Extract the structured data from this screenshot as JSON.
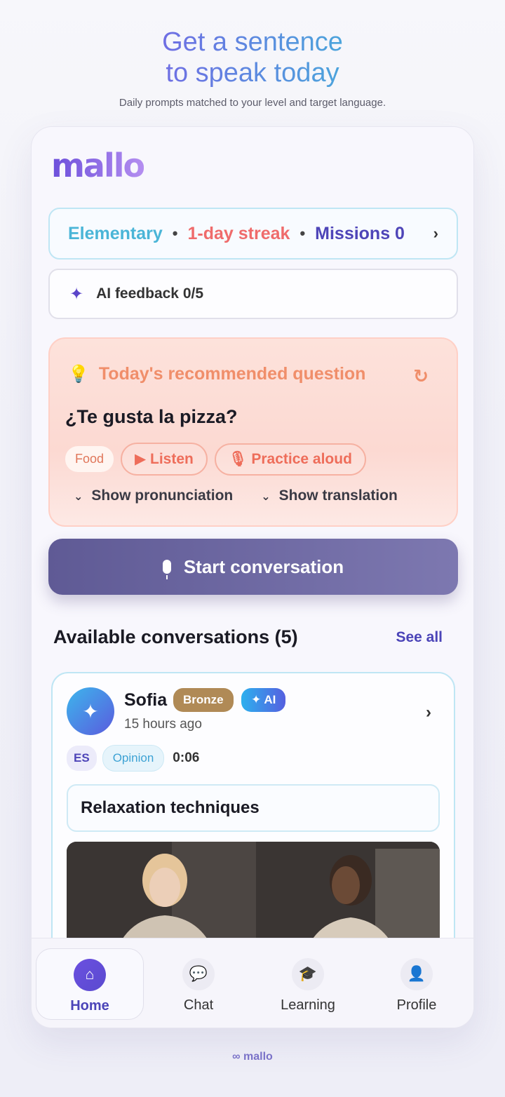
{
  "hero": {
    "title_line1": "Get a sentence",
    "title_line2": "to speak today",
    "subtitle": "Daily prompts matched to your level and target language."
  },
  "brand": {
    "logo": "mallo",
    "accent": "#6c4fdb",
    "secondary": "#4ab5d7"
  },
  "stats": {
    "level": "Elementary",
    "streak": "1-day streak",
    "missions": "Missions 0",
    "separator": "•",
    "chevron_icon": "chevron-right-icon"
  },
  "feedback": {
    "label": "AI feedback 0/5",
    "icon": "sparkles-icon"
  },
  "question_card": {
    "heading": "Today's recommended question",
    "question": "¿Te gusta la pizza?",
    "category": "Food",
    "listen_label": "Listen",
    "practice_label": "Practice aloud",
    "show_pronunciation": "Show pronunciation",
    "show_translation": "Show translation"
  },
  "start_button": {
    "label": "Start conversation",
    "icon": "microphone-icon"
  },
  "conversations": {
    "title": "Available conversations (5)",
    "see_all": "See all",
    "items": [
      {
        "name": "Sofia",
        "badge": "Bronze",
        "ai_badge": "AI",
        "time": "15 hours ago",
        "language": "ES",
        "type": "Opinion",
        "duration": "0:06",
        "topic": "Relaxation techniques"
      }
    ]
  },
  "tabs": [
    {
      "label": "Home",
      "icon": "home-icon",
      "active": true
    },
    {
      "label": "Chat",
      "icon": "chat-icon",
      "active": false
    },
    {
      "label": "Learning",
      "icon": "graduation-cap-icon",
      "active": false
    },
    {
      "label": "Profile",
      "icon": "person-icon",
      "active": false
    }
  ],
  "footer": {
    "logo": "mallo"
  }
}
